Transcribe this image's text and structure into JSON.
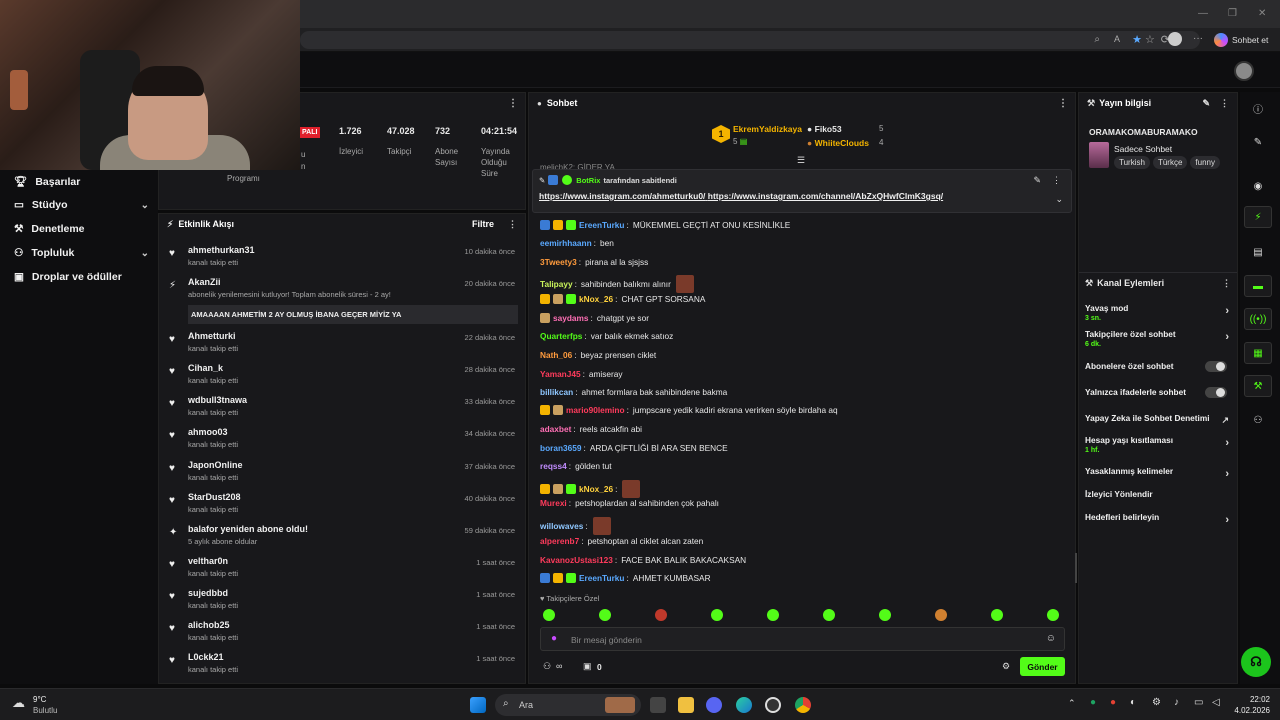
{
  "browser": {
    "chat_button": "Sohbet et"
  },
  "nav": {
    "items": [
      {
        "label": "Başarılar",
        "icon": "trophy-icon",
        "chevron": false
      },
      {
        "label": "Stüdyo",
        "icon": "studio-icon",
        "chevron": true
      },
      {
        "label": "Denetleme",
        "icon": "wrench-icon",
        "chevron": false
      },
      {
        "label": "Topluluk",
        "icon": "community-icon",
        "chevron": true
      },
      {
        "label": "Droplar ve ödüller",
        "icon": "gift-icon",
        "chevron": false
      }
    ]
  },
  "stats": {
    "live_badge": "PALI",
    "program_label": "Programı",
    "program_left_1": "u",
    "program_left_2": "n",
    "viewers": {
      "value": "1.726",
      "label": "İzleyici"
    },
    "followers": {
      "value": "47.028",
      "label": "Takipçi"
    },
    "subs": {
      "value": "732",
      "label_1": "Abone",
      "label_2": "Sayısı"
    },
    "uptime": {
      "value": "04:21:54",
      "label_1": "Yayında",
      "label_2": "Olduğu",
      "label_3": "Süre"
    }
  },
  "activity": {
    "title": "Etkinlik Akışı",
    "filter": "Filtre",
    "events": [
      {
        "name": "ahmethurkan31",
        "sub": "kanalı takip etti",
        "time": "10 dakika önce",
        "icon": "heart"
      },
      {
        "name": "AkanZii",
        "sub": "abonelik yenilemesini kutluyor! Toplam abonelik süresi - 2 ay!",
        "time": "20 dakika önce",
        "icon": "sub",
        "message": "AMAAAAN AHMETİM 2 AY OLMUŞ İBANA GEÇER MİYİZ YA"
      },
      {
        "name": "Ahmetturki",
        "sub": "kanalı takip etti",
        "time": "22 dakika önce",
        "icon": "heart"
      },
      {
        "name": "Cihan_k",
        "sub": "kanalı takip etti",
        "time": "28 dakika önce",
        "icon": "heart"
      },
      {
        "name": "wdbull3tnawa",
        "sub": "kanalı takip etti",
        "time": "33 dakika önce",
        "icon": "heart"
      },
      {
        "name": "ahmoo03",
        "sub": "kanalı takip etti",
        "time": "34 dakika önce",
        "icon": "heart"
      },
      {
        "name": "JaponOnline",
        "sub": "kanalı takip etti",
        "time": "37 dakika önce",
        "icon": "heart"
      },
      {
        "name": "StarDust208",
        "sub": "kanalı takip etti",
        "time": "40 dakika önce",
        "icon": "heart"
      },
      {
        "name": "balafor yeniden abone oldu!",
        "sub": "5 aylık abone oldular",
        "time": "59 dakika önce",
        "icon": "sparkle"
      },
      {
        "name": "velthar0n",
        "sub": "kanalı takip etti",
        "time": "1 saat önce",
        "icon": "heart"
      },
      {
        "name": "sujedbbd",
        "sub": "kanalı takip etti",
        "time": "1 saat önce",
        "icon": "heart"
      },
      {
        "name": "alichob25",
        "sub": "kanalı takip etti",
        "time": "1 saat önce",
        "icon": "heart"
      },
      {
        "name": "L0ckk21",
        "sub": "kanalı takip etti",
        "time": "1 saat önce",
        "icon": "heart"
      }
    ]
  },
  "chat": {
    "title": "Sohbet",
    "top_gifters": [
      {
        "rank": "1",
        "name": "EkremYaldizkaya",
        "count": "5",
        "color": "#f4b400"
      },
      {
        "rank": "",
        "name": "Fiko53",
        "count": "5",
        "color": "#e8e8e8"
      },
      {
        "rank": "",
        "name": "WhiiteClouds",
        "count": "4",
        "color": "#f4b400"
      }
    ],
    "partial_line": "melichK2: GİDER YA",
    "pinned": {
      "user": "BotRix",
      "by_text": "tarafından sabitlendi",
      "link1": "https://www.instagram.com/ahmetturku0/",
      "link2": "https://www.instagram.com/channel/AbZxQHwfClmK3gsq/"
    },
    "messages": [
      {
        "user": "EreenTurku",
        "color": "#5aa9ff",
        "text": "MÜKEMMEL GEÇTİ AT ONU KESİNLİKLE",
        "badges": [
          "#3a7bd5",
          "#f4b400",
          "#53fc18"
        ],
        "emote": false
      },
      {
        "user": "eemirhhaann",
        "color": "#5aa9ff",
        "text": "ben",
        "badges": [],
        "emote": false
      },
      {
        "user": "3Tweety3",
        "color": "#ff9b3d",
        "text": "pirana al la sjsjss",
        "badges": [],
        "emote": false
      },
      {
        "user": "Talipayy",
        "color": "#c9f35b",
        "text": "sahibinden balıkmı alınır",
        "badges": [],
        "emote": true
      },
      {
        "user": "kNox_26",
        "color": "#ffd23d",
        "text": "CHAT GPT SORSANA",
        "badges": [
          "#f4b400",
          "#c9a060",
          "#53fc18"
        ],
        "emote": false
      },
      {
        "user": "saydams",
        "color": "#ff6fb5",
        "text": "chatgpt ye sor",
        "badges": [
          "#c9a060"
        ],
        "emote": false
      },
      {
        "user": "Quarterfps",
        "color": "#53fc18",
        "text": "var balık ekmek satıoz",
        "badges": [],
        "emote": false
      },
      {
        "user": "Nath_06",
        "color": "#ff9b3d",
        "text": "beyaz prensen ciklet",
        "badges": [],
        "emote": false
      },
      {
        "user": "YamanJ45",
        "color": "#ff3b5c",
        "text": "amiseray",
        "badges": [],
        "emote": false
      },
      {
        "user": "billikcan",
        "color": "#8fc7ff",
        "text": "ahmet formlara bak sahibindene bakma",
        "badges": [],
        "emote": false
      },
      {
        "user": "mario90lemino",
        "color": "#ff3b5c",
        "text": "jumpscare yedik kadiri ekrana verirken söyle birdaha aq",
        "badges": [
          "#f4b400",
          "#c9a060"
        ],
        "emote": false
      },
      {
        "user": "adaxbet",
        "color": "#ff6fb5",
        "text": "reels atcakfin abi",
        "badges": [],
        "emote": false
      },
      {
        "user": "boran3659",
        "color": "#5aa9ff",
        "text": "ARDA ÇİFTLİĞİ Bİ ARA SEN BENCE",
        "badges": [],
        "emote": false
      },
      {
        "user": "reqss4",
        "color": "#c18cff",
        "text": "gölden tut",
        "badges": [],
        "emote": false
      },
      {
        "user": "kNox_26",
        "color": "#ffd23d",
        "text": "",
        "badges": [
          "#f4b400",
          "#c9a060",
          "#53fc18"
        ],
        "emote": true
      },
      {
        "user": "Murexi",
        "color": "#ff3b5c",
        "text": "petshoplardan al sahibinden çok pahalı",
        "badges": [],
        "emote": false
      },
      {
        "user": "willowaves",
        "color": "#8fc7ff",
        "text": "",
        "badges": [],
        "emote": true
      },
      {
        "user": "alperenb7",
        "color": "#ff3b5c",
        "text": "petshoptan al ciklet alcan zaten",
        "badges": [],
        "emote": false
      },
      {
        "user": "KavanozUstasi123",
        "color": "#ff3b5c",
        "text": "FACE BAK BALIK BAKACAKSAN",
        "badges": [],
        "emote": false
      },
      {
        "user": "EreenTurku",
        "color": "#5aa9ff",
        "text": "AHMET KUMBASAR",
        "badges": [
          "#3a7bd5",
          "#f4b400",
          "#53fc18"
        ],
        "emote": false
      }
    ],
    "followers_only": "Takipçilere Özel",
    "input_placeholder": "Bir mesaj gönderin",
    "points_count": "0",
    "send": "Gönder"
  },
  "stream_info": {
    "title": "Yayın bilgisi",
    "stream_title": "ORAMAKOMABURAMAKO",
    "category": "Sadece Sohbet",
    "tags": [
      "Turkish",
      "Türkçe",
      "funny"
    ]
  },
  "channel_actions": {
    "title": "Kanal Eylemleri",
    "items": [
      {
        "label": "Yavaş mod",
        "value": "3 sn.",
        "control": "arrow"
      },
      {
        "label": "Takipçilere özel sohbet",
        "value": "6 dk.",
        "control": "arrow"
      },
      {
        "label": "Abonelere özel sohbet",
        "value": "",
        "control": "toggle"
      },
      {
        "label": "Yalnızca ifadelerle sohbet",
        "value": "",
        "control": "toggle"
      },
      {
        "label": "Yapay Zeka ile Sohbet Denetimi",
        "value": "",
        "control": "external"
      },
      {
        "label": "Hesap yaşı kısıtlaması",
        "value": "1 hf.",
        "control": "arrow"
      },
      {
        "label": "Yasaklanmış kelimeler",
        "value": "",
        "control": "arrow"
      },
      {
        "label": "İzleyici Yönlendir",
        "value": "",
        "control": "none"
      },
      {
        "label": "Hedefleri belirleyin",
        "value": "",
        "control": "arrow"
      }
    ]
  },
  "taskbar": {
    "weather_temp": "9°C",
    "weather_desc": "Bulutlu",
    "search": "Ara",
    "time": "22:02",
    "date": "4.02.2026"
  },
  "colors": {
    "accent": "#53fc18",
    "panel": "#18181b",
    "bg": "#0b0b0c"
  }
}
